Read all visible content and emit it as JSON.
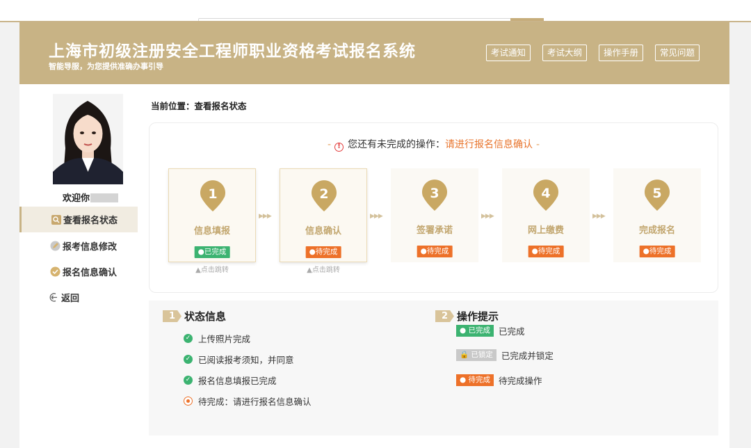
{
  "header": {
    "title": "上海市初级注册安全工程师职业资格考试报名系统",
    "subtitle": "智能导服，为您提供准确办事引导",
    "nav": [
      "考试通知",
      "考试大纲",
      "操作手册",
      "常见问题"
    ]
  },
  "sidebar": {
    "welcome": "欢迎你",
    "items": [
      {
        "label": "查看报名状态",
        "icon": "search-icon",
        "active": true
      },
      {
        "label": "报考信息修改",
        "icon": "edit-icon",
        "active": false
      },
      {
        "label": "报名信息确认",
        "icon": "check-circle-icon",
        "active": false
      },
      {
        "label": "返回",
        "icon": "back-icon",
        "active": false
      }
    ]
  },
  "breadcrumb": "当前位置：查看报名状态",
  "notice": {
    "dash_left": "-",
    "text": "您还有未完成的操作：",
    "link": "请进行报名信息确认",
    "dash_right": "-"
  },
  "steps": [
    {
      "num": "1",
      "label": "信息填报",
      "status": "●已完成",
      "state": "done",
      "jump": "▲点击跳转"
    },
    {
      "num": "2",
      "label": "信息确认",
      "status": "●待完成",
      "state": "current",
      "jump": "▲点击跳转"
    },
    {
      "num": "3",
      "label": "签署承诺",
      "status": "●待完成",
      "state": "pending",
      "jump": ""
    },
    {
      "num": "4",
      "label": "网上缴费",
      "status": "●待完成",
      "state": "pending",
      "jump": ""
    },
    {
      "num": "5",
      "label": "完成报名",
      "status": "●待完成",
      "state": "pending",
      "jump": ""
    }
  ],
  "status_info": {
    "num": "1",
    "title": "状态信息",
    "items": [
      {
        "text": "上传照片完成",
        "state": "ok"
      },
      {
        "text": "已阅读报考须知，并同意",
        "state": "ok"
      },
      {
        "text": "报名信息填报已完成",
        "state": "ok"
      },
      {
        "text": "待完成：请进行报名信息确认",
        "state": "pending"
      }
    ]
  },
  "tips": {
    "num": "2",
    "title": "操作提示",
    "items": [
      {
        "badge": "● 已完成",
        "text": "已完成",
        "type": "ok"
      },
      {
        "badge": "🔒 已锁定",
        "text": "已完成并锁定",
        "type": "lock"
      },
      {
        "badge": "● 待完成",
        "text": "待完成操作",
        "type": "todo"
      }
    ]
  },
  "colors": {
    "brand": "#c8b385",
    "done": "#3cb371",
    "todo": "#ed7129",
    "step_label": "#c2a66e"
  }
}
